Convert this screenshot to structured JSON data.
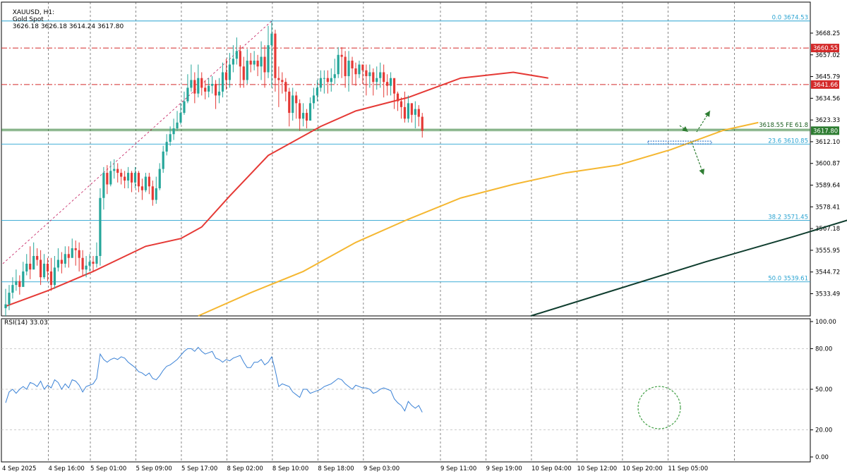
{
  "header": {
    "symbol": "XAUUSD, H1:",
    "name": "Gold Spot",
    "ohlc": "3626.18 3626.18 3614.24 3617.80"
  },
  "rsi_label": "RSI(14) 33.03",
  "colors": {
    "bull": "#26a69a",
    "bear": "#e53935",
    "ma_fast": "#e53935",
    "ma_slow": "#f5b731",
    "ma_long": "#0f3d2e",
    "fib": "#29a3d1",
    "resistance": "#d42a2a",
    "support_zone": "#2e7d32",
    "rsi": "#3b82d6",
    "annotation": "#2e7d32"
  },
  "icons": [
    "arrow-up-right-icon",
    "arrow-down-right-icon",
    "arrow-down-icon",
    "circle-highlight-icon"
  ],
  "chart_data": {
    "type": "candlestick",
    "symbol": "XAUUSD",
    "timeframe": "H1",
    "y_ticks": [
      3668.25,
      3657.02,
      3645.79,
      3634.56,
      3623.33,
      3612.1,
      3600.87,
      3589.64,
      3578.41,
      3567.18,
      3555.95,
      3544.72,
      3533.49
    ],
    "ylim": [
      3522,
      3681
    ],
    "x_ticks": [
      "4 Sep 2025",
      "4 Sep 16:00",
      "5 Sep 01:00",
      "5 Sep 09:00",
      "5 Sep 17:00",
      "8 Sep 02:00",
      "8 Sep 10:00",
      "8 Sep 18:00",
      "9 Sep 03:00",
      "9 Sep 11:00",
      "9 Sep 19:00",
      "10 Sep 04:00",
      "10 Sep 12:00",
      "10 Sep 20:00",
      "11 Sep 05:00"
    ],
    "closes": [
      3528,
      3534,
      3538,
      3540,
      3537,
      3545,
      3549,
      3546,
      3553,
      3551,
      3542,
      3549,
      3545,
      3538,
      3547,
      3551,
      3549,
      3554,
      3552,
      3557,
      3556,
      3552,
      3546,
      3548,
      3550,
      3549,
      3553,
      3583,
      3596,
      3590,
      3597,
      3598,
      3596,
      3594,
      3592,
      3596,
      3591,
      3596,
      3589,
      3587,
      3594,
      3589,
      3582,
      3588,
      3598,
      3607,
      3612,
      3616,
      3619,
      3622,
      3627,
      3633,
      3640,
      3644,
      3637,
      3645,
      3640,
      3638,
      3641,
      3642,
      3636,
      3638,
      3648,
      3644,
      3652,
      3655,
      3659,
      3651,
      3644,
      3654,
      3652,
      3654,
      3651,
      3656,
      3648,
      3662,
      3668,
      3645,
      3644,
      3643,
      3638,
      3627,
      3636,
      3632,
      3624,
      3627,
      3623,
      3632,
      3636,
      3640,
      3645,
      3645,
      3643,
      3645,
      3647,
      3657,
      3656,
      3646,
      3654,
      3650,
      3647,
      3652,
      3649,
      3646,
      3648,
      3643,
      3645,
      3648,
      3643,
      3641,
      3645,
      3637,
      3633,
      3630,
      3624,
      3632,
      3626,
      3629,
      3625,
      3617.8
    ],
    "highs": [
      3536,
      3538,
      3542,
      3546,
      3543,
      3550,
      3554,
      3558,
      3560,
      3557,
      3556,
      3554,
      3552,
      3552,
      3553,
      3557,
      3555,
      3558,
      3558,
      3562,
      3561,
      3560,
      3556,
      3553,
      3554,
      3553,
      3560,
      3588,
      3599,
      3600,
      3602,
      3603,
      3601,
      3598,
      3597,
      3599,
      3597,
      3599,
      3597,
      3593,
      3596,
      3596,
      3592,
      3594,
      3601,
      3610,
      3616,
      3620,
      3624,
      3628,
      3632,
      3638,
      3647,
      3652,
      3648,
      3652,
      3648,
      3644,
      3645,
      3646,
      3644,
      3645,
      3653,
      3655,
      3658,
      3662,
      3666,
      3662,
      3656,
      3660,
      3658,
      3659,
      3657,
      3664,
      3662,
      3672,
      3674.5,
      3670,
      3651,
      3648,
      3645,
      3640,
      3640,
      3638,
      3634,
      3632,
      3629,
      3635,
      3640,
      3644,
      3649,
      3649,
      3649,
      3650,
      3655,
      3661,
      3661,
      3659,
      3659,
      3656,
      3653,
      3654,
      3652,
      3652,
      3652,
      3650,
      3651,
      3653,
      3652,
      3647,
      3648,
      3644,
      3638,
      3635,
      3638,
      3636,
      3632,
      3633,
      3631,
      3627
    ],
    "lows": [
      3522,
      3525,
      3531,
      3535,
      3533,
      3540,
      3543,
      3541,
      3546,
      3548,
      3538,
      3541,
      3540,
      3535,
      3536,
      3545,
      3544,
      3547,
      3547,
      3552,
      3548,
      3545,
      3543,
      3542,
      3545,
      3545,
      3547,
      3548,
      3577,
      3585,
      3589,
      3593,
      3591,
      3590,
      3588,
      3588,
      3586,
      3588,
      3586,
      3582,
      3586,
      3585,
      3579,
      3580,
      3587,
      3596,
      3605,
      3610,
      3613,
      3618,
      3621,
      3626,
      3632,
      3638,
      3632,
      3635,
      3636,
      3634,
      3635,
      3637,
      3629,
      3632,
      3635,
      3639,
      3640,
      3648,
      3652,
      3640,
      3640,
      3642,
      3648,
      3649,
      3646,
      3644,
      3640,
      3645,
      3640,
      3638,
      3630,
      3637,
      3633,
      3620,
      3623,
      3624,
      3618,
      3620,
      3619,
      3624,
      3629,
      3633,
      3638,
      3637,
      3637,
      3638,
      3642,
      3645,
      3645,
      3640,
      3638,
      3642,
      3641,
      3645,
      3642,
      3636,
      3640,
      3636,
      3639,
      3640,
      3635,
      3636,
      3636,
      3629,
      3628,
      3624,
      3622,
      3622,
      3622,
      3619,
      3620,
      3614.24
    ],
    "ma_fast": {
      "points": [
        [
          0,
          3527
        ],
        [
          12,
          3535
        ],
        [
          25,
          3545
        ],
        [
          40,
          3558
        ],
        [
          50,
          3562
        ],
        [
          56,
          3568
        ],
        [
          64,
          3584
        ],
        [
          75,
          3605
        ],
        [
          90,
          3620
        ],
        [
          100,
          3628
        ],
        [
          115,
          3635
        ],
        [
          130,
          3645
        ],
        [
          145,
          3648
        ],
        [
          155,
          3645
        ]
      ]
    },
    "ma_slow": {
      "points": [
        [
          55,
          3522
        ],
        [
          70,
          3534
        ],
        [
          85,
          3545
        ],
        [
          100,
          3560
        ],
        [
          115,
          3572
        ],
        [
          130,
          3583
        ],
        [
          145,
          3590
        ],
        [
          160,
          3596
        ],
        [
          175,
          3600
        ],
        [
          190,
          3608
        ],
        [
          205,
          3618
        ],
        [
          215,
          3622
        ]
      ]
    },
    "ma_long": {
      "points": [
        [
          150,
          3522
        ],
        [
          175,
          3536
        ],
        [
          200,
          3550
        ],
        [
          225,
          3563
        ],
        [
          245,
          3574
        ]
      ]
    },
    "horizontal_levels": [
      {
        "label": "0.0 3674.53",
        "value": 3674.53,
        "kind": "fib"
      },
      {
        "label": "3660.55",
        "value": 3660.55,
        "kind": "resistance"
      },
      {
        "label": "3641.66",
        "value": 3641.66,
        "kind": "resistance"
      },
      {
        "label": "3618.55 FE 61.8",
        "value": 3618.55,
        "kind": "support"
      },
      {
        "label": "3617.80",
        "value": 3617.8,
        "kind": "price"
      },
      {
        "label": "23.6 3610.85",
        "value": 3610.85,
        "kind": "fib"
      },
      {
        "label": "38.2 3571.45",
        "value": 3571.45,
        "kind": "fib"
      },
      {
        "label": "50.0 3539.61",
        "value": 3539.61,
        "kind": "fib"
      }
    ],
    "rsi": {
      "name": "RSI(14)",
      "current": 33.03,
      "y_ticks": [
        100.0,
        80.0,
        50.0,
        20.0,
        0.0
      ],
      "ylim": [
        0,
        100
      ],
      "values": [
        40,
        48,
        50,
        47,
        50,
        52,
        50,
        55,
        54,
        52,
        56,
        50,
        53,
        51,
        57,
        55,
        50,
        54,
        51,
        57,
        56,
        53,
        48,
        52,
        53,
        54,
        58,
        76,
        72,
        70,
        72,
        73,
        72,
        74,
        73,
        70,
        68,
        66,
        63,
        62,
        60,
        62,
        58,
        57,
        60,
        64,
        67,
        68,
        70,
        72,
        75,
        78,
        80,
        80,
        78,
        81,
        78,
        76,
        77,
        78,
        73,
        72,
        70,
        72,
        71,
        73,
        74,
        75,
        70,
        66,
        66,
        70,
        70,
        72,
        68,
        70,
        74,
        64,
        52,
        54,
        53,
        52,
        48,
        46,
        44,
        50,
        50,
        47,
        48,
        49,
        50,
        52,
        53,
        54,
        56,
        58,
        57,
        54,
        52,
        50,
        53,
        52,
        51,
        51,
        50,
        47,
        48,
        50,
        51,
        50,
        49,
        43,
        40,
        38,
        34,
        41,
        38,
        36,
        38,
        33.03
      ]
    }
  }
}
